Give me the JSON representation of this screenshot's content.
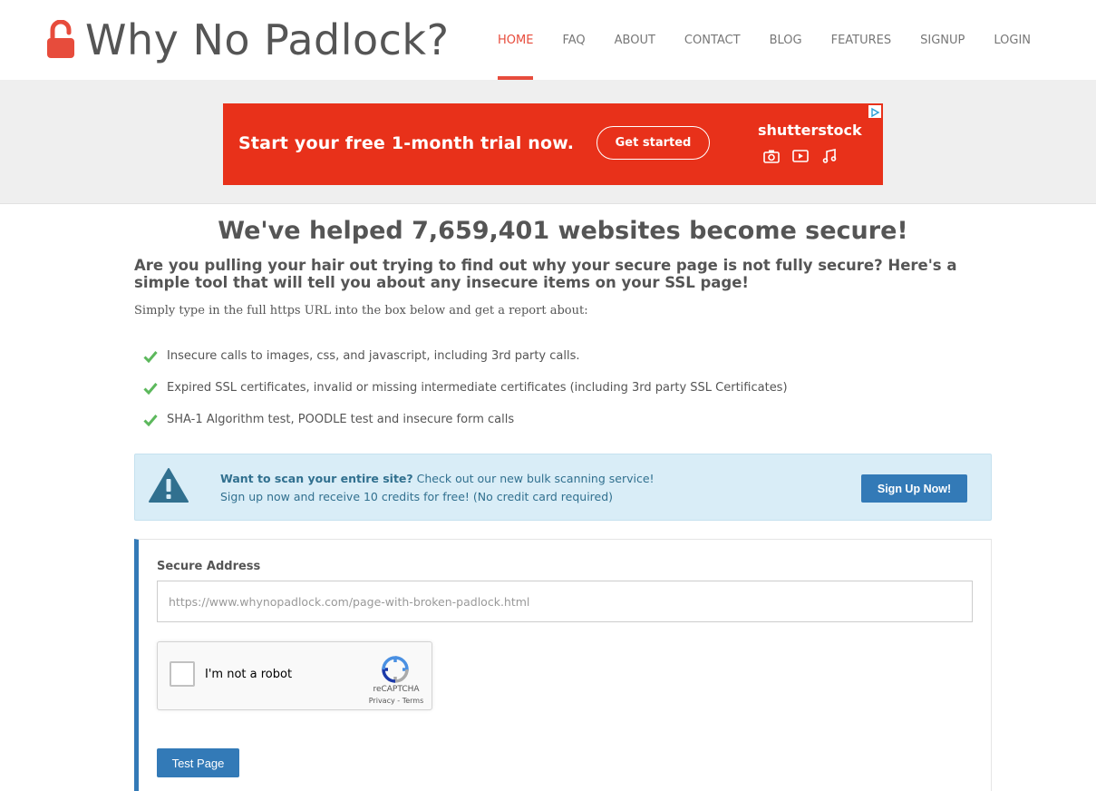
{
  "brand": {
    "logo_text": "Why No Padlock?",
    "logo_icon": "unlocked-padlock-icon",
    "accent_color": "#e74c3c"
  },
  "nav": {
    "items": [
      {
        "label": "HOME",
        "active": true
      },
      {
        "label": "FAQ",
        "active": false
      },
      {
        "label": "ABOUT",
        "active": false
      },
      {
        "label": "CONTACT",
        "active": false
      },
      {
        "label": "BLOG",
        "active": false
      },
      {
        "label": "FEATURES",
        "active": false
      },
      {
        "label": "SIGNUP",
        "active": false
      },
      {
        "label": "LOGIN",
        "active": false
      }
    ]
  },
  "ad": {
    "headline": "Start your free 1-month trial now.",
    "button": "Get started",
    "brand": "shutterstock",
    "background": "#e8311a",
    "icons": [
      "camera-icon",
      "play-icon",
      "music-icon"
    ]
  },
  "main": {
    "headline": "We've helped 7,659,401 websites become secure!",
    "subheadline": "Are you pulling your hair out trying to find out why your secure page is not fully secure? Here's a simple tool that will tell you about any insecure items on your SSL page!",
    "intro": "Simply type in the full https URL into the box below and get a report about:",
    "features": [
      "Insecure calls to images, css, and javascript, including 3rd party calls.",
      "Expired SSL certificates, invalid or missing intermediate certificates (including 3rd party SSL Certificates)",
      "SHA-1 Algorithm test, POODLE test and insecure form calls"
    ],
    "check_color": "#5cb85c"
  },
  "alert": {
    "bold": "Want to scan your entire site?",
    "text": " Check out our new bulk scanning service!",
    "line2": "Sign up now and receive 10 credits for free! (No credit card required)",
    "button": "Sign Up Now!",
    "text_color": "#31708f",
    "background": "#d9edf7"
  },
  "form": {
    "label": "Secure Address",
    "value": "",
    "placeholder": "https://www.whynopadlock.com/page-with-broken-padlock.html",
    "captcha_label": "I'm not a robot",
    "captcha_brand": "reCAPTCHA",
    "captcha_links": "Privacy - Terms",
    "submit": "Test Page",
    "primary_color": "#337ab7"
  }
}
